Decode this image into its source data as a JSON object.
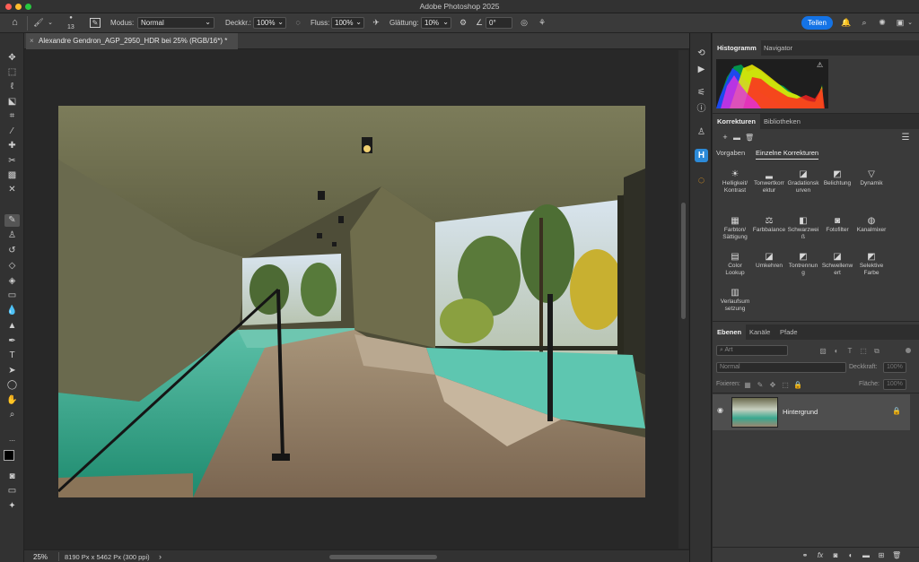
{
  "app": {
    "title": "Adobe Photoshop 2025"
  },
  "options_bar": {
    "brush_size": "13",
    "mode_label": "Modus:",
    "mode_value": "Normal",
    "opacity_label": "Deckkr.:",
    "opacity_value": "100%",
    "flow_label": "Fluss:",
    "flow_value": "100%",
    "smoothing_label": "Glättung:",
    "smoothing_value": "10%",
    "angle_value": "0°",
    "share_label": "Teilen"
  },
  "document": {
    "tab_title": "Alexandre Gendron_AGP_2950_HDR bei 25% (RGB/16*) *"
  },
  "status": {
    "zoom": "25%",
    "dimensions": "8190 Px x 5462 Px (300 ppi)",
    "arrow": "›"
  },
  "histogram_panel": {
    "tabs": [
      "Histogramm",
      "Navigator"
    ],
    "warning": "⚠"
  },
  "adjustments_panel": {
    "tabs": [
      "Korrekturen",
      "Bibliotheken"
    ],
    "subtabs": [
      "Vorgaben",
      "Einzelne Korrekturen"
    ],
    "items": [
      {
        "label": "Helligkeit/\nKontrast",
        "icon": "☀"
      },
      {
        "label": "Tonwertkorr\nektur",
        "icon": "▂"
      },
      {
        "label": "Gradationsk\nurven",
        "icon": "◪"
      },
      {
        "label": "Belichtung",
        "icon": "◩"
      },
      {
        "label": "Dynamik",
        "icon": "▽"
      },
      {
        "label": "Farbton/\nSättigung",
        "icon": "▦"
      },
      {
        "label": "Farbbalance",
        "icon": "⚖"
      },
      {
        "label": "Schwarzwei\nß",
        "icon": "◧"
      },
      {
        "label": "Fotofilter",
        "icon": "◙"
      },
      {
        "label": "Kanalmixer",
        "icon": "◍"
      },
      {
        "label": "Color\nLookup",
        "icon": "▤"
      },
      {
        "label": "Umkehren",
        "icon": "◪"
      },
      {
        "label": "Tontrennun\ng",
        "icon": "◩"
      },
      {
        "label": "Schwellenw\nert",
        "icon": "◪"
      },
      {
        "label": "Selektive\nFarbe",
        "icon": "◩"
      },
      {
        "label": "Verlaufsum\nsetzung",
        "icon": "▥"
      }
    ]
  },
  "layers_panel": {
    "tabs": [
      "Ebenen",
      "Kanäle",
      "Pfade"
    ],
    "filter_placeholder": "Art",
    "blend_mode": "Normal",
    "opacity_label": "Deckkraft:",
    "opacity_value": "100%",
    "lock_label": "Fixieren:",
    "fill_label": "Fläche:",
    "fill_value": "100%",
    "layers": [
      {
        "name": "Hintergrund",
        "visible_icon": "👁"
      }
    ]
  },
  "colors": {
    "accent": "#1473e6",
    "panel": "#3a3a3a",
    "canvas": "#282828"
  }
}
